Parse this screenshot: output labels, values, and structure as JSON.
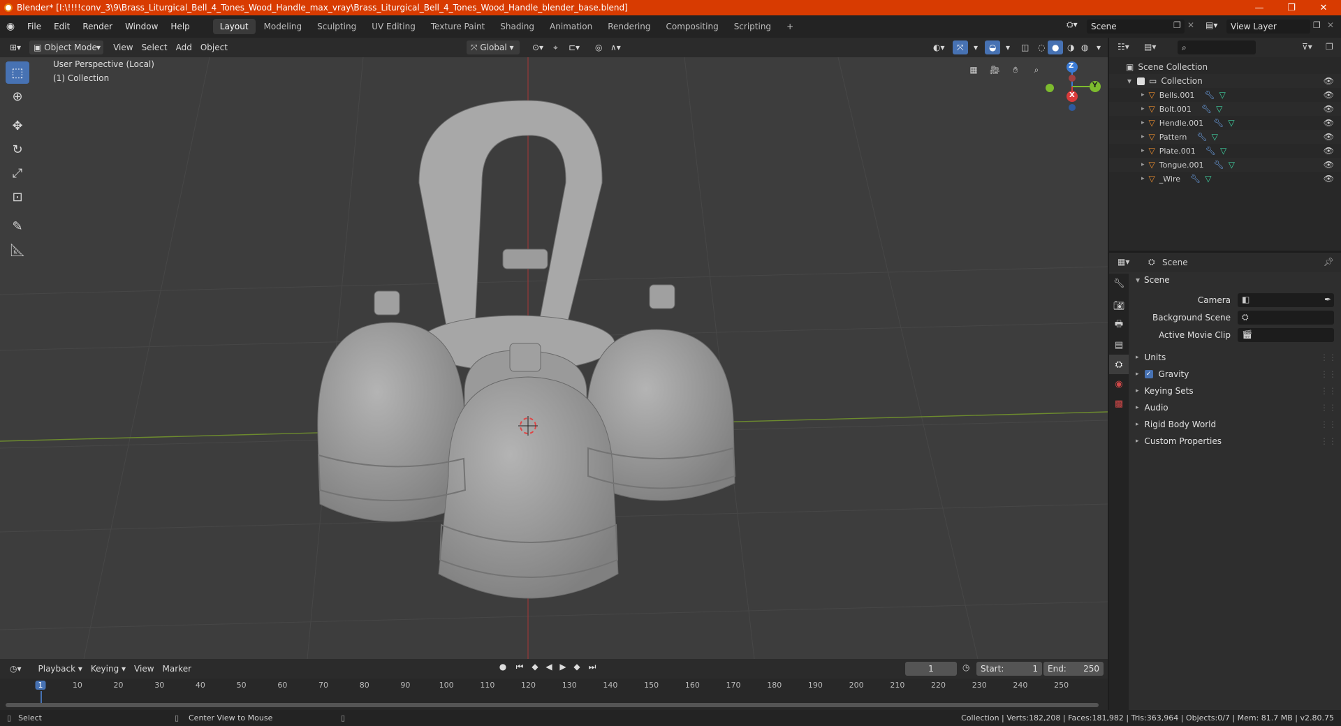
{
  "window": {
    "title": "Blender* [I:\\!!!!conv_3\\9\\Brass_Liturgical_Bell_4_Tones_Wood_Handle_max_vray\\Brass_Liturgical_Bell_4_Tones_Wood_Handle_blender_base.blend]",
    "minimize": "—",
    "restore": "❐",
    "close": "✕"
  },
  "menu": {
    "items": [
      "File",
      "Edit",
      "Render",
      "Window",
      "Help"
    ],
    "workspaces": [
      "Layout",
      "Modeling",
      "Sculpting",
      "UV Editing",
      "Texture Paint",
      "Shading",
      "Animation",
      "Rendering",
      "Compositing",
      "Scripting"
    ],
    "add_workspace": "+",
    "scene_name": "Scene",
    "view_layer": "View Layer"
  },
  "viewport_header": {
    "mode": "Object Mode",
    "menus": [
      "View",
      "Select",
      "Add",
      "Object"
    ],
    "orientation": "Global"
  },
  "viewport": {
    "perspective_label": "User Perspective (Local)",
    "collection_label": "(1) Collection",
    "gizmo": {
      "z": "Z",
      "y": "Y",
      "x": "X"
    }
  },
  "outliner": {
    "search_placeholder": "",
    "scene_collection": "Scene Collection",
    "collection": "Collection",
    "objects": [
      "Bells.001",
      "Bolt.001",
      "Hendle.001",
      "Pattern",
      "Plate.001",
      "Tongue.001",
      "_Wire"
    ]
  },
  "properties": {
    "header_title": "Scene",
    "panel_title": "Scene",
    "fields": [
      {
        "label": "Camera",
        "value": ""
      },
      {
        "label": "Background Scene",
        "value": ""
      },
      {
        "label": "Active Movie Clip",
        "value": ""
      }
    ],
    "subpanels": [
      "Units",
      "Gravity",
      "Keying Sets",
      "Audio",
      "Rigid Body World",
      "Custom Properties"
    ]
  },
  "timeline": {
    "menus": [
      "Playback",
      "Keying",
      "View",
      "Marker"
    ],
    "current_frame": "1",
    "start_label": "Start:",
    "start": "1",
    "end_label": "End:",
    "end": "250",
    "ruler": [
      "1",
      "10",
      "20",
      "30",
      "40",
      "50",
      "60",
      "70",
      "80",
      "90",
      "100",
      "110",
      "120",
      "130",
      "140",
      "150",
      "160",
      "170",
      "180",
      "190",
      "200",
      "210",
      "220",
      "230",
      "240",
      "250"
    ]
  },
  "status": {
    "left_action": "Select",
    "middle_action": "Center View to Mouse",
    "stats": "Collection | Verts:182,208 | Faces:181,982 | Tris:363,964 | Objects:0/7 | Mem: 81.7 MB | v2.80.75"
  },
  "colors": {
    "titlebar": "#d83b01",
    "accent": "#4772b3",
    "object_icon": "#e68a2e",
    "mesh_icon": "#3fd0a0"
  }
}
